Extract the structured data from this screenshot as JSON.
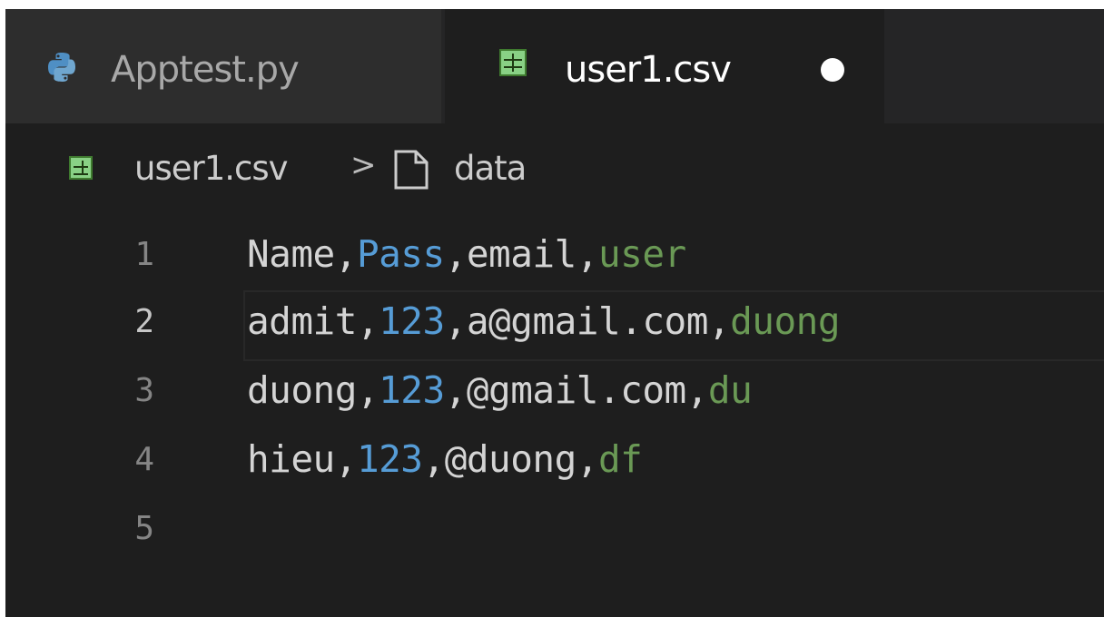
{
  "tabs": [
    {
      "label": "Apptest.py",
      "icon": "python-icon",
      "active": false
    },
    {
      "label": "user1.csv",
      "icon": "csv-table-icon",
      "active": true,
      "dirty": true
    }
  ],
  "breadcrumb": {
    "file": "user1.csv",
    "separator": ">",
    "symbol": "data"
  },
  "editor": {
    "current_line": 2,
    "lines": [
      {
        "number": "1",
        "cells": [
          "Name",
          "Pass",
          "email",
          "user"
        ]
      },
      {
        "number": "2",
        "cells": [
          "admit",
          "123",
          "a@gmail.com",
          "duong"
        ]
      },
      {
        "number": "3",
        "cells": [
          "duong",
          "123",
          "@gmail.com",
          "du"
        ]
      },
      {
        "number": "4",
        "cells": [
          "hieu",
          "123",
          "@duong",
          "df"
        ]
      },
      {
        "number": "5",
        "cells": []
      }
    ]
  },
  "colors": {
    "background": "#1e1e1e",
    "column_1": "#d4d4d4",
    "column_2": "#569cd6",
    "column_3": "#d4d4d4",
    "column_4": "#6a9955"
  }
}
